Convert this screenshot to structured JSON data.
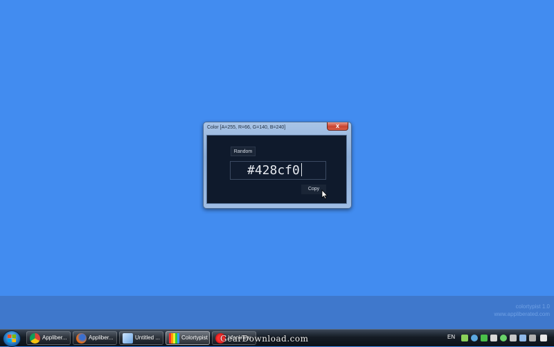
{
  "window": {
    "title": "Color [A=255, R=66, G=140, B=240]",
    "close_label": "x",
    "random_label": "Random",
    "hex_value": "#428cf0",
    "copy_label": "Copy"
  },
  "desktop": {
    "background_color": "#428cf0",
    "app_name": "colortypist 1.0",
    "app_url": "www.appliberated.com"
  },
  "taskbar": {
    "tasks": [
      {
        "label": "Appliber...",
        "icon": "chrome-icon"
      },
      {
        "label": "Appliber...",
        "icon": "firefox-icon"
      },
      {
        "label": "Untitled ...",
        "icon": "notepad-icon"
      },
      {
        "label": "Colortypist",
        "icon": "colortypist-icon",
        "active": true
      },
      {
        "label": "IrfanView",
        "icon": "irfanview-icon"
      }
    ],
    "language": "EN",
    "watermark": "GearDownload.com"
  }
}
